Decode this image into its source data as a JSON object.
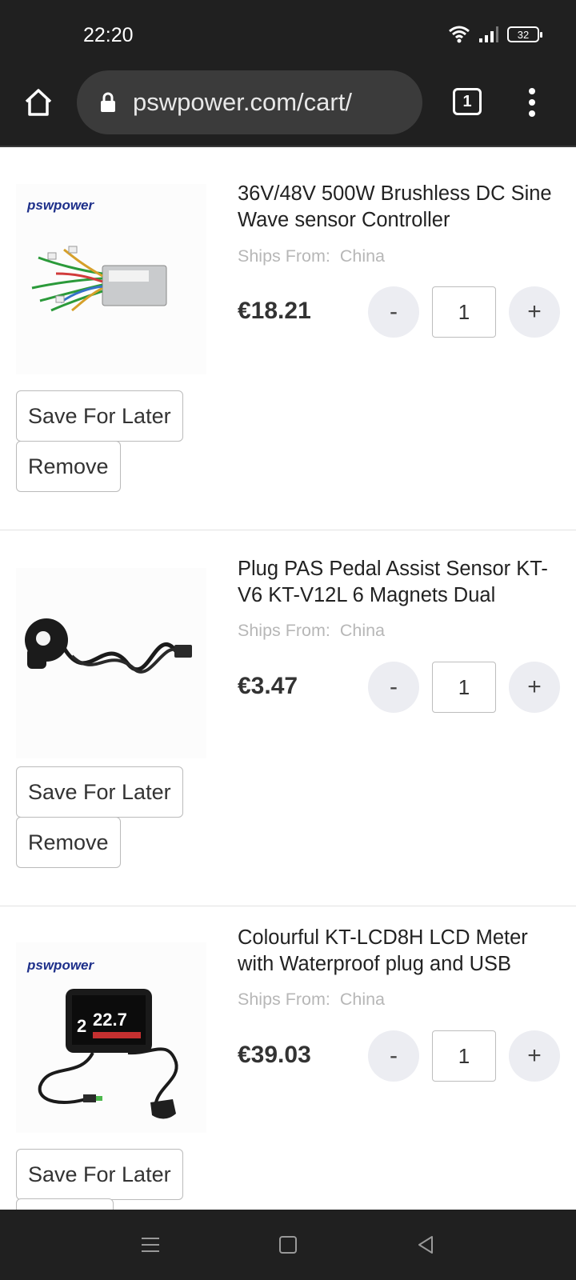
{
  "status_bar": {
    "time": "22:20",
    "battery": "32"
  },
  "browser": {
    "url": "pswpower.com/cart/",
    "tab_count": "1"
  },
  "cart": {
    "items": [
      {
        "title": "36V/48V 500W Brushless DC Sine Wave sensor Controller",
        "ships_from_label": "Ships From:",
        "ships_from": "China",
        "price": "€18.21",
        "quantity": "1",
        "minus": "-",
        "plus": "+",
        "save_label": "Save For Later",
        "remove_label": "Remove",
        "brand": "pswpower"
      },
      {
        "title": "Plug PAS Pedal Assist Sensor KT-V6 KT-V12L 6 Magnets Dual",
        "ships_from_label": "Ships From:",
        "ships_from": "China",
        "price": "€3.47",
        "quantity": "1",
        "minus": "-",
        "plus": "+",
        "save_label": "Save For Later",
        "remove_label": "Remove"
      },
      {
        "title": "Colourful KT-LCD8H LCD Meter with Waterproof plug and USB",
        "ships_from_label": "Ships From:",
        "ships_from": "China",
        "price": "€39.03",
        "quantity": "1",
        "minus": "-",
        "plus": "+",
        "save_label": "Save For Later",
        "brand": "pswpower",
        "display": {
          "left": "2",
          "main": "22.7"
        }
      }
    ]
  }
}
